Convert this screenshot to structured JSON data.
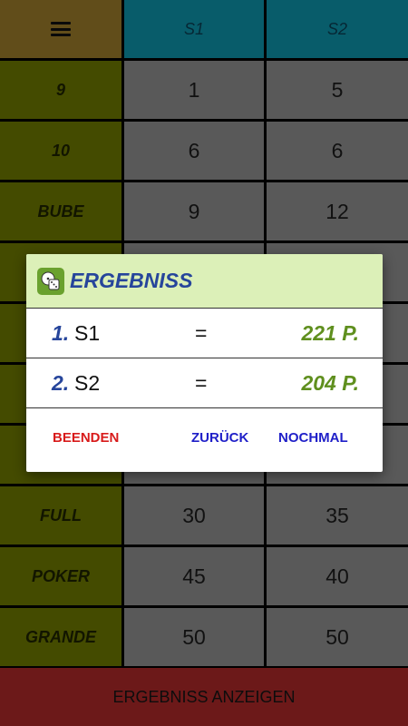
{
  "grid": {
    "players": [
      "S1",
      "S2"
    ],
    "rows": [
      {
        "label": "9",
        "s1": "1",
        "s2": "5"
      },
      {
        "label": "10",
        "s1": "6",
        "s2": "6"
      },
      {
        "label": "BUBE",
        "s1": "9",
        "s2": "12"
      },
      {
        "label": "",
        "s1": "",
        "s2": ""
      },
      {
        "label": "",
        "s1": "",
        "s2": ""
      },
      {
        "label": "",
        "s1": "",
        "s2": ""
      },
      {
        "label": "",
        "s1": "",
        "s2": ""
      },
      {
        "label": "FULL",
        "s1": "30",
        "s2": "35"
      },
      {
        "label": "POKER",
        "s1": "45",
        "s2": "40"
      },
      {
        "label": "GRANDE",
        "s1": "50",
        "s2": "50"
      }
    ]
  },
  "bottom_button": {
    "label": "ERGEBNISS ANZEIGEN"
  },
  "dialog": {
    "title": "ERGEBNISS",
    "icon": "dice-icon",
    "results": [
      {
        "rank": "1.",
        "name": "S1",
        "eq": "=",
        "points": "221 P."
      },
      {
        "rank": "2.",
        "name": "S2",
        "eq": "=",
        "points": "204 P."
      }
    ],
    "actions": {
      "quit": "BEENDEN",
      "back": "ZURÜCK",
      "again": "NOCHMAL"
    }
  },
  "colors": {
    "header_menu": "#9d7c2b",
    "header_player": "#0d95ab",
    "label_cell": "#6e7a00",
    "score_cell": "#909090",
    "bottom_button": "#6c1919",
    "dialog_header": "#dcf0b8",
    "accent_blue": "#26459b",
    "points_green": "#5f8f1e",
    "quit_red": "#d81b1b",
    "action_blue": "#1f1fc8"
  }
}
